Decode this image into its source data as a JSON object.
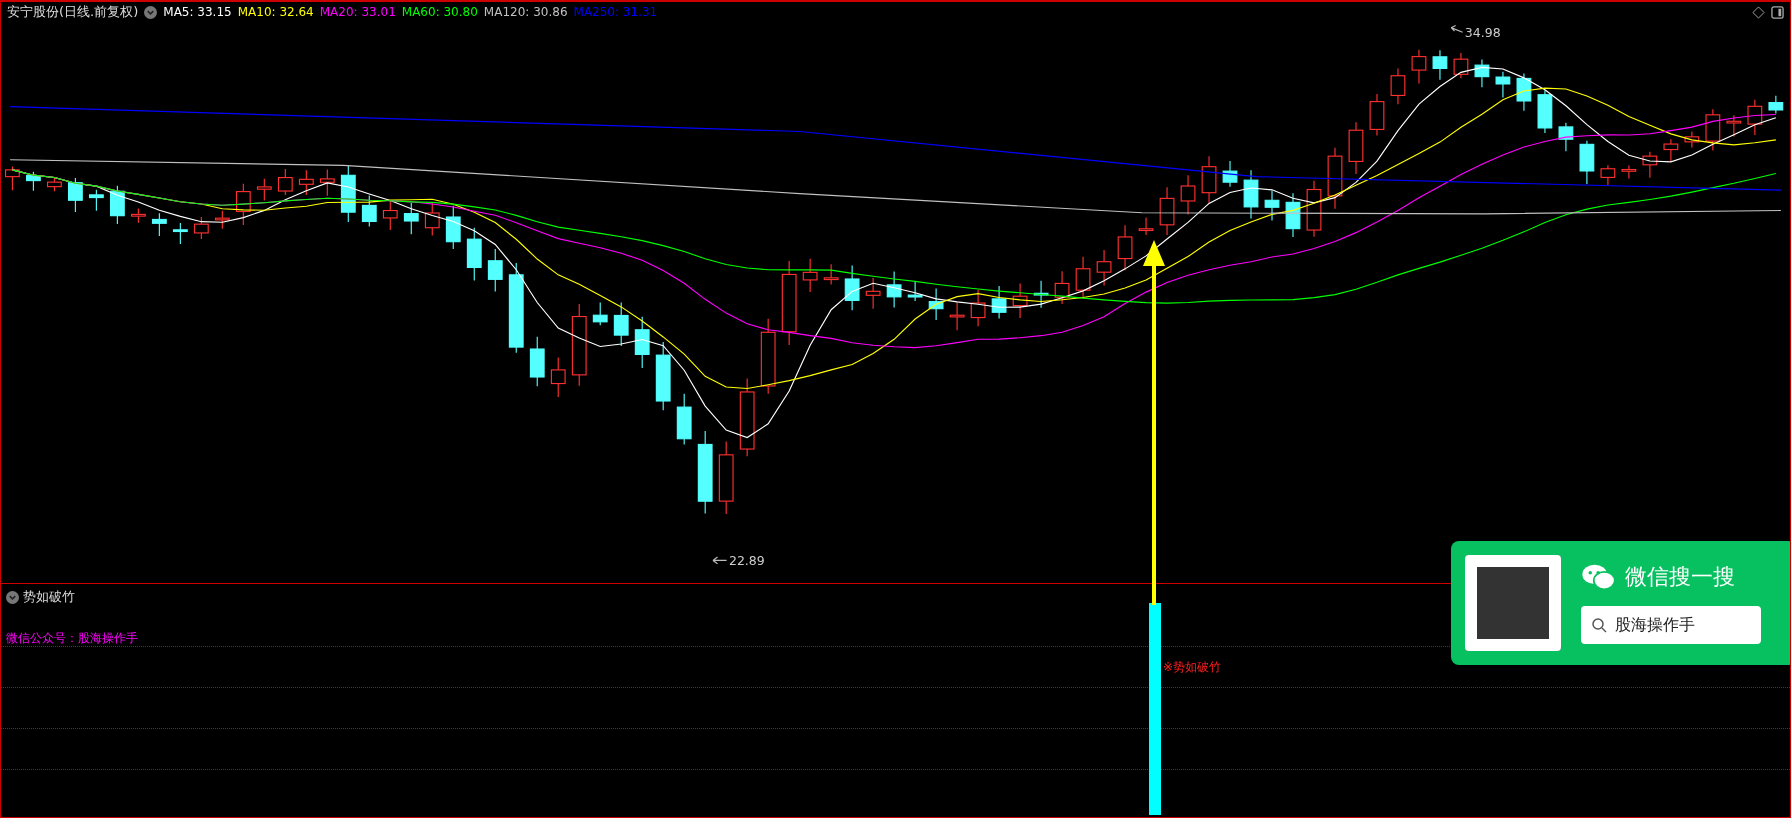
{
  "header": {
    "title": "安宁股份(日线.前复权)",
    "ma": [
      {
        "label": "MA5: 33.15",
        "color": "#ffffff"
      },
      {
        "label": "MA10: 32.64",
        "color": "#ffff00"
      },
      {
        "label": "MA20: 33.01",
        "color": "#ff00ff"
      },
      {
        "label": "MA60: 30.80",
        "color": "#00ff00"
      },
      {
        "label": "MA120: 30.86",
        "color": "#c0c0c0"
      },
      {
        "label": "MA250: 31.31",
        "color": "#0000ff"
      }
    ]
  },
  "main_chart": {
    "high_label": "34.98",
    "low_label": "22.89"
  },
  "indicator_panel": {
    "title": "势如破竹",
    "note": "微信公众号：股海操作手",
    "signal_label": "※势如破竹"
  },
  "wechat_card": {
    "title": "微信搜一搜",
    "search_text": "股海操作手"
  }
}
